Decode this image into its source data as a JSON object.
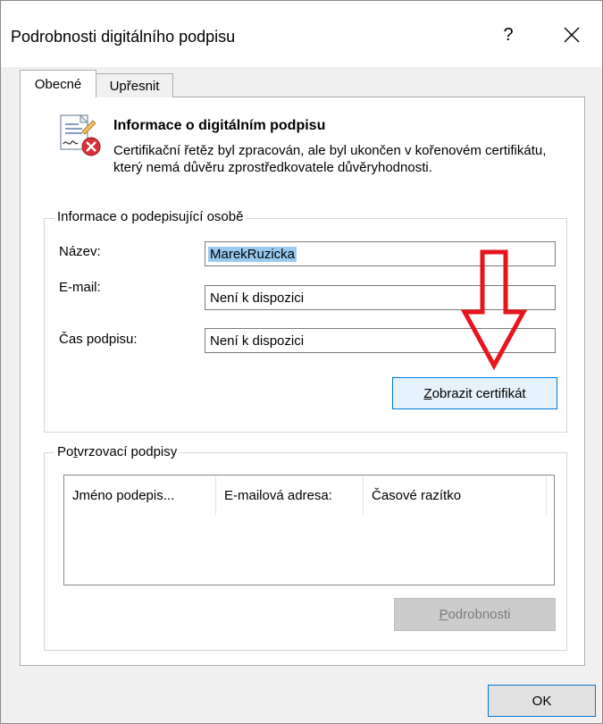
{
  "window": {
    "title": "Podrobnosti digitálního podpisu",
    "help_label": "?",
    "close_icon": "close-icon"
  },
  "tabs": [
    {
      "label": "Obecné",
      "active": true
    },
    {
      "label": "Upřesnit",
      "active": false
    }
  ],
  "info": {
    "icon": "signature-error-icon",
    "title": "Informace o digitálním podpisu",
    "description": "Certifikační řetěz byl zpracován, ale byl ukončen v kořenovém certifikátu, který nemá důvěru zprostředkovatele důvěryhodnosti."
  },
  "signer": {
    "group_label": "Informace o podepisující osobě",
    "name_label": "Název:",
    "name_value": "MarekRuzicka",
    "email_label": "E-mail:",
    "email_value": "Není k dispozici",
    "time_label": "Čas podpisu:",
    "time_value": "Není k dispozici",
    "view_cert_button": {
      "underline": "Z",
      "rest": "obrazit certifikát"
    }
  },
  "countersignatures": {
    "group_label_pre": "Po",
    "group_label_u": "t",
    "group_label_post": "vrzovací podpisy",
    "columns": [
      "Jméno podepis...",
      "E-mailová adresa:",
      "Časové razítko"
    ],
    "details_button": {
      "underline": "P",
      "rest": "odrobnosti"
    }
  },
  "footer": {
    "ok_label": "OK"
  },
  "colors": {
    "arrow": "#e8141b",
    "accent": "#0078d7",
    "selection": "#99c9ef"
  }
}
